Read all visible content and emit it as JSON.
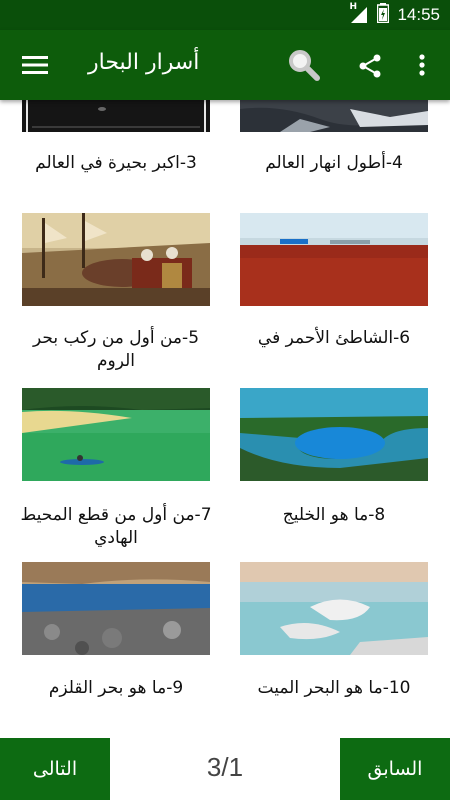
{
  "status_bar": {
    "time": "14:55",
    "network_label": "H"
  },
  "app_bar": {
    "title": "أسرار البحار",
    "icons": [
      "menu-icon",
      "search-icon",
      "share-icon",
      "more-vert-icon"
    ]
  },
  "colors": {
    "app_bar": "#0d5c0b",
    "status_bar": "#0a4f0a",
    "nav_button": "#0d6b12"
  },
  "articles": [
    {
      "label": "3-اكبر بحيرة في العالم",
      "image": "dark lake at night"
    },
    {
      "label": "4-أطول انهار العالم",
      "image": "river waterfall"
    },
    {
      "label": "5-من أول من ركب بحر الروم",
      "image": "historic painting of ships and soldiers"
    },
    {
      "label": "6-الشاطئ الأحمر في",
      "image": "red beach"
    },
    {
      "label": "7-من أول من قطع المحيط الهادي",
      "image": "green lagoon with kayak"
    },
    {
      "label": "8-ما هو الخليج",
      "image": "blue bay aerial view"
    },
    {
      "label": "9-ما هو بحر القلزم",
      "image": "rocky sea shore"
    },
    {
      "label": "10-ما هو البحر الميت",
      "image": "dead sea salt formations"
    }
  ],
  "footer": {
    "next_label": "التالى",
    "previous_label": "السابق",
    "page_indicator": "3/1"
  }
}
